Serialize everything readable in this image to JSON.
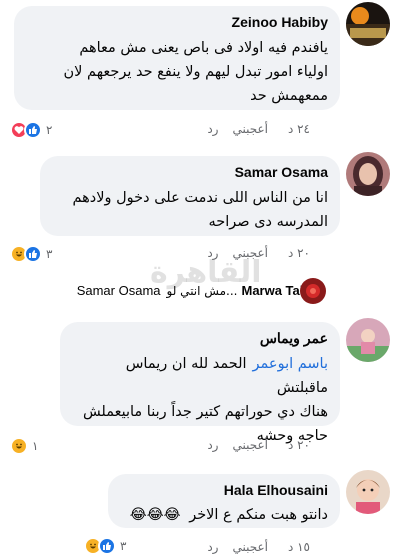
{
  "comments": [
    {
      "author": "Zeinoo Habiby",
      "text_lines": [
        "يافندم فيه اولاد فى باص يعنى مش معاهم",
        "اولياء امور تبدل ليهم ولا ينفع حد يرجعهم لان",
        "ممعهمش حد"
      ],
      "time": "٢٤ د",
      "like_label": "أعجبني",
      "reply_label": "رد",
      "reactions": [
        "like-icon",
        "love-icon"
      ],
      "reaction_count": "٢"
    },
    {
      "author": "Samar Osama",
      "text_lines": [
        "انا من الناس اللى ندمت على دخول ولادهم",
        "المدرسه دى صراحه"
      ],
      "time": "٢٠ د",
      "like_label": "أعجبني",
      "reply_label": "رد",
      "reactions": [
        "like-icon",
        "haha-icon"
      ],
      "reaction_count": "٣",
      "reply_preview": {
        "author": "Marwa Taher",
        "text": "مش انتي لو...",
        "target": "Samar Osama"
      }
    },
    {
      "author": "عمر ويماس",
      "mention": "باسم ابوعمر",
      "text_lines": [
        "الحمد لله ان ريماس ماقبلتش",
        "هناك دي حوراتهم كتير جداً ربنا مابيعملش",
        "حاجه وحشه"
      ],
      "time": "٢٠ د",
      "like_label": "أعجبني",
      "reply_label": "رد",
      "reactions": [
        "haha-icon"
      ],
      "reaction_count": "١"
    },
    {
      "author": "Hala Elhousaini",
      "text_lines": [
        "دانتو هبت منكم ع الاخر"
      ],
      "emoji": "😂😂😂",
      "time": "١٥ د",
      "like_label": "أعجبني",
      "reply_label": "رد",
      "reactions": [
        "like-icon",
        "haha-icon"
      ],
      "reaction_count": "٣"
    }
  ],
  "watermark": "القاهرة",
  "colors": {
    "bubble": "#f0f2f5",
    "meta": "#65676b",
    "link": "#216fdb",
    "like": "#1b74e4",
    "love": "#f33e58",
    "haha": "#f7b125"
  }
}
